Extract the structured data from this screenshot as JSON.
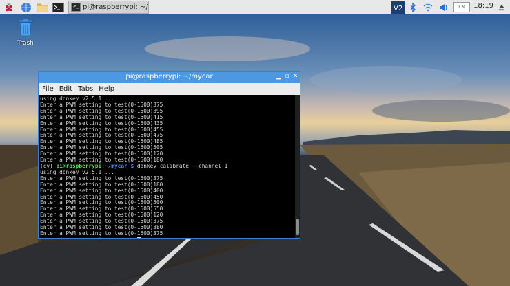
{
  "taskbar": {
    "task_label": "pi@raspberrypi: ~/my...",
    "volume_percent": "? %",
    "clock": "18:19"
  },
  "desktop": {
    "trash_label": "Trash"
  },
  "terminal_window": {
    "title": "pi@raspberrypi: ~/mycar",
    "menu": [
      "File",
      "Edit",
      "Tabs",
      "Help"
    ],
    "prompt_env": "(cv)",
    "prompt_user_host": "pi@raspberrypi",
    "prompt_path": ":~/mycar $",
    "lines_block1": [
      "using donkey v2.5.1 ...",
      "Enter a PWM setting to test(0-1500)375",
      "Enter a PWM setting to test(0-1500)395",
      "Enter a PWM setting to test(0-1500)415",
      "Enter a PWM setting to test(0-1500)435",
      "Enter a PWM setting to test(0-1500)455",
      "Enter a PWM setting to test(0-1500)475",
      "Enter a PWM setting to test(0-1500)485",
      "Enter a PWM setting to test(0-1500)505",
      "Enter a PWM setting to test(0-1500)120",
      "Enter a PWM setting to test(0-1500)180"
    ],
    "command": " donkey calibrate --channel 1",
    "lines_block2": [
      "using donkey v2.5.1 ...",
      "Enter a PWM setting to test(0-1500)375",
      "Enter a PWM setting to test(0-1500)180",
      "Enter a PWM setting to test(0-1500)400",
      "Enter a PWM setting to test(0-1500)450",
      "Enter a PWM setting to test(0-1500)500",
      "Enter a PWM setting to test(0-1500)550",
      "Enter a PWM setting to test(0-1500)120",
      "Enter a PWM setting to test(0-1500)375",
      "Enter a PWM setting to test(0-1500)380",
      "Enter a PWM setting to test(0-1500)375"
    ]
  },
  "colors": {
    "title_bar": "#4d98e3",
    "prompt_green": "#4fe24f",
    "prompt_blue": "#5a8cff"
  }
}
